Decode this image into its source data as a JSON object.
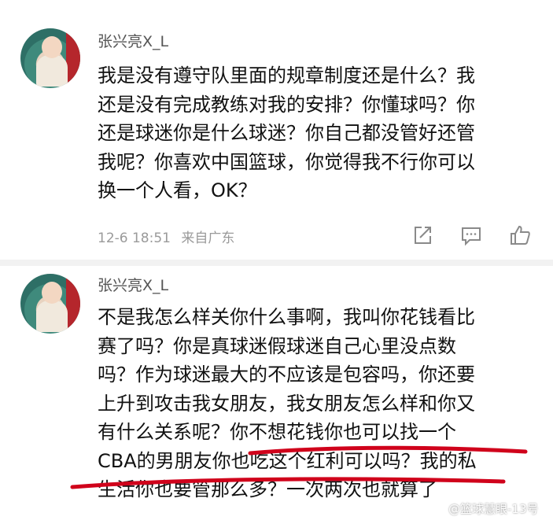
{
  "comments": [
    {
      "username": "张兴亮X_L",
      "lines": [
        "我是没有遵守队里面的规章制度还是什么？我",
        "还是没有完成教练对我的安排？你懂球吗？你",
        "还是球迷你是什么球迷？你自己都没管好还管",
        "我呢？你喜欢中国篮球，你觉得我不行你可以",
        "换一个人看，OK？"
      ],
      "date": "12-6 18:51",
      "location": "来自广东",
      "actions": {
        "share_icon": "share-icon",
        "comment_icon": "comment-icon",
        "like_icon": "thumbs-up-icon"
      }
    },
    {
      "username": "张兴亮X_L",
      "lines": [
        "不是我怎么样关你什么事啊，我叫你花钱看比",
        "赛了吗？你是真球迷假球迷自己心里没点数",
        "吗？作为球迷最大的不应该是包容吗，你还要",
        "上升到攻击我女朋友，我女朋友怎么样和你又",
        "有什么关系呢？你不想花钱你也可以找一个",
        "CBA的男朋友你也吃这个红利可以吗？我的私",
        "生活你也要管那么多？一次两次也就算了"
      ]
    }
  ],
  "watermark": "@篮球慧眼-13号",
  "colors": {
    "underline": "#d0021b",
    "meta": "#9a9a9a",
    "divider": "#f2f2f2"
  }
}
